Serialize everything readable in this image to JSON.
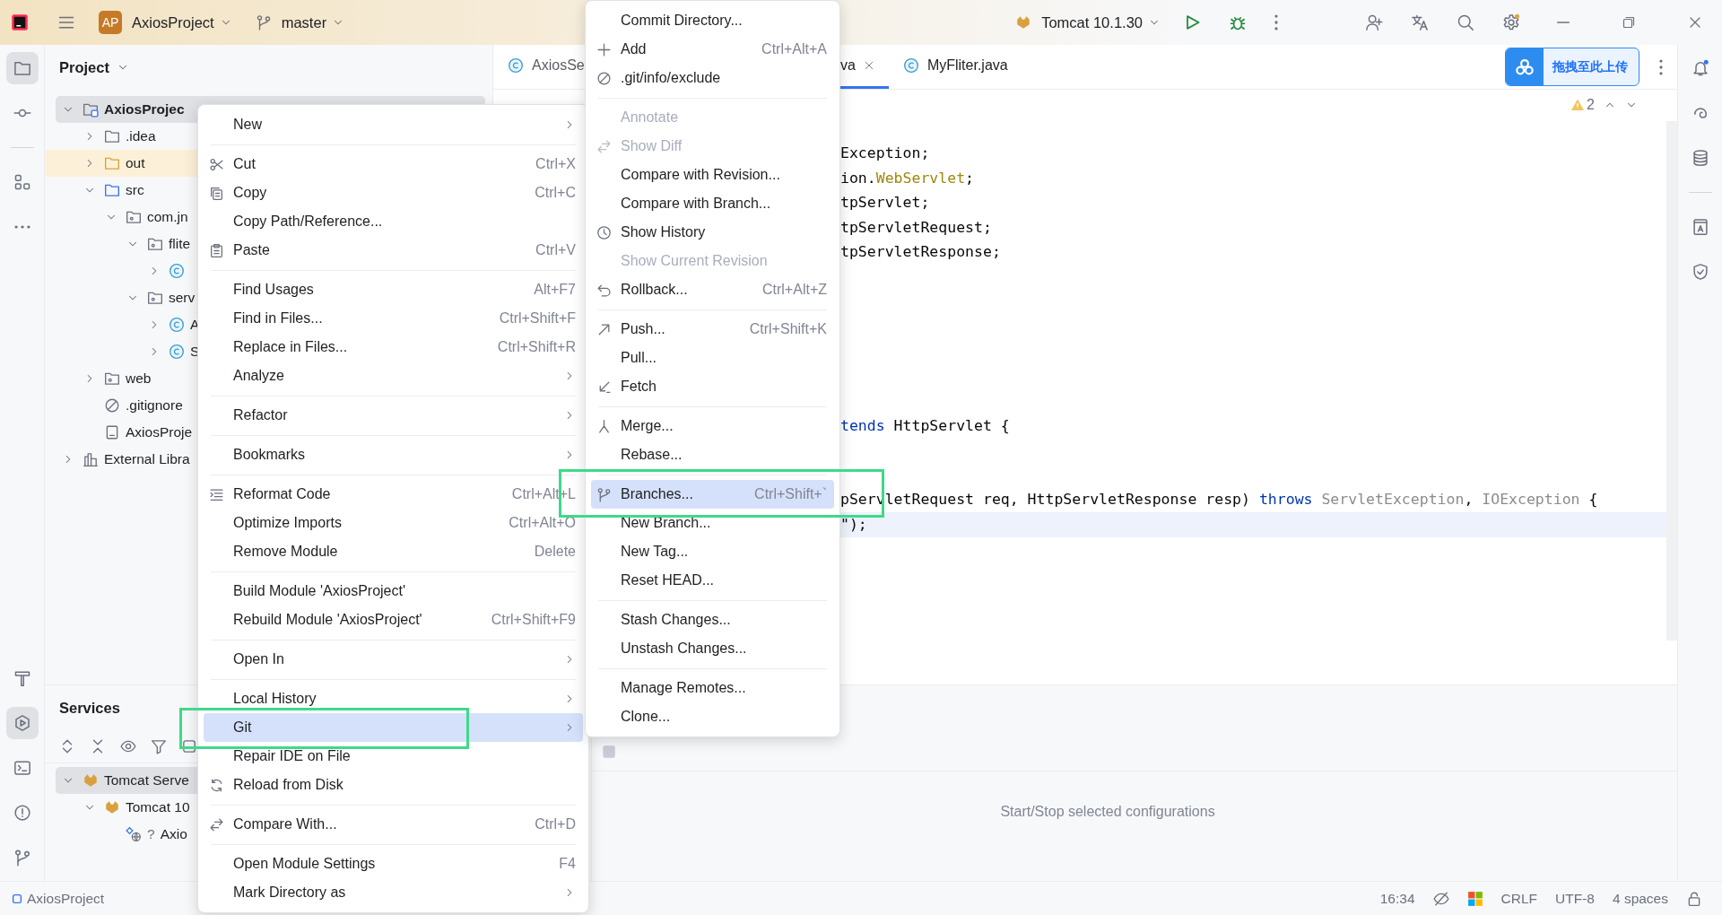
{
  "topbar": {
    "project_badge": "AP",
    "project": "AxiosProject",
    "branch": "master",
    "run_config": "Tomcat 10.1.30"
  },
  "left_toolbar": {
    "top": [
      {
        "selected": true
      },
      {
        "selected": false
      },
      {
        "selected": false
      },
      {
        "selected": false
      }
    ],
    "bottom": [
      {
        "selected": false
      },
      {
        "selected": true
      },
      {
        "selected": false
      },
      {
        "selected": false
      },
      {
        "selected": false
      }
    ]
  },
  "project": {
    "title": "Project",
    "tree": [
      {
        "label": "AxiosProjec",
        "kind": "module",
        "expanded": true,
        "selected": true,
        "excluded": false,
        "children": [
          {
            "label": ".idea",
            "kind": "folder",
            "expanded": false,
            "selected": false,
            "excluded": false
          },
          {
            "label": "out",
            "kind": "folder",
            "expanded": false,
            "selected": false,
            "excluded": true
          },
          {
            "label": "src",
            "kind": "source",
            "expanded": true,
            "selected": false,
            "excluded": false,
            "children": [
              {
                "label": "com.jn",
                "kind": "package",
                "expanded": true,
                "selected": false,
                "excluded": false,
                "children": [
                  {
                    "label": "flite",
                    "kind": "package",
                    "expanded": true,
                    "selected": false,
                    "excluded": false,
                    "children": [
                      {
                        "kind": "class",
                        "expanded": false,
                        "selected": false,
                        "excluded": false
                      }
                    ]
                  },
                  {
                    "label": "serv",
                    "kind": "package",
                    "expanded": true,
                    "selected": false,
                    "excluded": false,
                    "children": [
                      {
                        "label": "A",
                        "kind": "class",
                        "expanded": false,
                        "selected": false,
                        "excluded": false
                      },
                      {
                        "label": "S",
                        "kind": "class",
                        "expanded": false,
                        "selected": false,
                        "excluded": false
                      }
                    ]
                  }
                ]
              }
            ]
          },
          {
            "label": "web",
            "kind": "package",
            "expanded": false,
            "selected": false,
            "excluded": false
          },
          {
            "label": ".gitignore",
            "kind": "ignore",
            "selected": false,
            "excluded": false
          },
          {
            "label": "AxiosProje",
            "kind": "file",
            "selected": false,
            "excluded": false
          }
        ]
      },
      {
        "label": "External Libra",
        "kind": "library",
        "expanded": false,
        "selected": false,
        "excluded": false
      }
    ]
  },
  "editor": {
    "tabs": [
      {
        "label": "AxiosSe",
        "kind": "class",
        "selected": false
      },
      {
        "label": "va",
        "kind": "plain",
        "selected": true,
        "closable": true
      },
      {
        "label": "MyFliter.java",
        "kind": "class",
        "selected": false,
        "closable": false
      }
    ],
    "upload_button": "拖拽至此上传",
    "warnings": "2",
    "lines": [
      {
        "kind": "code",
        "current": false,
        "segments": [
          {
            "kind": "plain",
            "text": "Exception;"
          }
        ]
      },
      {
        "kind": "code",
        "current": false,
        "segments": [
          {
            "kind": "plain",
            "text": "ion."
          },
          {
            "kind": "annotation",
            "text": "WebServlet"
          },
          {
            "kind": "plain",
            "text": ";"
          }
        ]
      },
      {
        "kind": "code",
        "current": false,
        "segments": [
          {
            "kind": "plain",
            "text": "tpServlet;"
          }
        ]
      },
      {
        "kind": "code",
        "current": false,
        "segments": [
          {
            "kind": "plain",
            "text": "tpServletRequest;"
          }
        ]
      },
      {
        "kind": "code",
        "current": false,
        "segments": [
          {
            "kind": "plain",
            "text": "tpServletResponse;"
          }
        ]
      },
      {
        "kind": "blank",
        "current": false
      },
      {
        "kind": "blank",
        "current": false
      },
      {
        "kind": "blank",
        "current": false
      },
      {
        "kind": "blank",
        "current": false
      },
      {
        "kind": "blank",
        "current": false
      },
      {
        "kind": "blank",
        "current": false
      },
      {
        "kind": "code",
        "current": false,
        "segments": [
          {
            "kind": "keyword",
            "text": "tends"
          },
          {
            "kind": "plain",
            "text": " HttpServlet {"
          }
        ]
      },
      {
        "kind": "blank",
        "current": false
      },
      {
        "kind": "blank",
        "current": false
      },
      {
        "kind": "code",
        "current": false,
        "segments": [
          {
            "kind": "plain",
            "text": "pServletRequest req, HttpServletResponse resp) "
          },
          {
            "kind": "keyword",
            "text": "throws"
          },
          {
            "kind": "muted",
            "text": " ServletException"
          },
          {
            "kind": "plain",
            "text": ", "
          },
          {
            "kind": "muted",
            "text": "IOException"
          },
          {
            "kind": "plain",
            "text": " {"
          }
        ]
      },
      {
        "kind": "code",
        "current": true,
        "segments": [
          {
            "kind": "plain",
            "text": "\");"
          }
        ]
      }
    ]
  },
  "services": {
    "title": "Services",
    "hint": "Start/Stop selected configurations",
    "tree": [
      {
        "label": "Tomcat Serve",
        "kind": "server",
        "expanded": true,
        "selected": true,
        "children": [
          {
            "label": "Tomcat 10",
            "kind": "server",
            "expanded": true,
            "selected": false,
            "children": [
              {
                "label": "Axio",
                "prefix": "?",
                "kind": "artifact",
                "selected": false
              }
            ]
          }
        ]
      }
    ]
  },
  "status_bar": {
    "project": "AxiosProject",
    "items": [
      {
        "kind": "text",
        "text": "16:34"
      },
      {
        "kind": "vcs"
      },
      {
        "kind": "os"
      },
      {
        "kind": "text",
        "text": "CRLF"
      },
      {
        "kind": "text",
        "text": "UTF-8"
      },
      {
        "kind": "text",
        "text": "4 spaces"
      },
      {
        "kind": "lock"
      }
    ]
  },
  "context_menu": {
    "groups": [
      {
        "items": [
          {
            "label": "New",
            "kind": "plain",
            "submenu": true,
            "selected": false
          }
        ]
      },
      {
        "items": [
          {
            "label": "Cut",
            "shortcut": "Ctrl+X",
            "kind": "cut",
            "submenu": false,
            "selected": false
          },
          {
            "label": "Copy",
            "shortcut": "Ctrl+C",
            "kind": "copy",
            "submenu": false,
            "selected": false
          },
          {
            "label": "Copy Path/Reference...",
            "kind": "plain",
            "submenu": false,
            "selected": false
          },
          {
            "label": "Paste",
            "shortcut": "Ctrl+V",
            "kind": "paste",
            "submenu": false,
            "selected": false
          }
        ]
      },
      {
        "items": [
          {
            "label": "Find Usages",
            "shortcut": "Alt+F7",
            "kind": "plain",
            "submenu": false,
            "selected": false
          },
          {
            "label": "Find in Files...",
            "shortcut": "Ctrl+Shift+F",
            "kind": "plain",
            "submenu": false,
            "selected": false
          },
          {
            "label": "Replace in Files...",
            "shortcut": "Ctrl+Shift+R",
            "kind": "plain",
            "submenu": false,
            "selected": false
          },
          {
            "label": "Analyze",
            "kind": "plain",
            "submenu": true,
            "selected": false
          }
        ]
      },
      {
        "items": [
          {
            "label": "Refactor",
            "kind": "plain",
            "submenu": true,
            "selected": false
          }
        ]
      },
      {
        "items": [
          {
            "label": "Bookmarks",
            "kind": "plain",
            "submenu": true,
            "selected": false
          }
        ]
      },
      {
        "items": [
          {
            "label": "Reformat Code",
            "shortcut": "Ctrl+Alt+L",
            "kind": "format",
            "submenu": false,
            "selected": false
          },
          {
            "label": "Optimize Imports",
            "shortcut": "Ctrl+Alt+O",
            "kind": "plain",
            "submenu": false,
            "selected": false
          },
          {
            "label": "Remove Module",
            "shortcut": "Delete",
            "kind": "plain",
            "submenu": false,
            "selected": false
          }
        ]
      },
      {
        "items": [
          {
            "label": "Build Module 'AxiosProject'",
            "kind": "plain",
            "submenu": false,
            "selected": false
          },
          {
            "label": "Rebuild Module 'AxiosProject'",
            "shortcut": "Ctrl+Shift+F9",
            "kind": "plain",
            "submenu": false,
            "selected": false
          }
        ]
      },
      {
        "items": [
          {
            "label": "Open In",
            "kind": "plain",
            "submenu": true,
            "selected": false
          }
        ]
      },
      {
        "items": [
          {
            "label": "Local History",
            "kind": "plain",
            "submenu": true,
            "selected": false
          },
          {
            "label": "Git",
            "kind": "plain",
            "submenu": true,
            "selected": true
          },
          {
            "label": "Repair IDE on File",
            "kind": "plain",
            "submenu": false,
            "selected": false
          },
          {
            "label": "Reload from Disk",
            "kind": "reload",
            "submenu": false,
            "selected": false
          }
        ]
      },
      {
        "items": [
          {
            "label": "Compare With...",
            "shortcut": "Ctrl+D",
            "kind": "compare",
            "submenu": false,
            "selected": false
          }
        ]
      },
      {
        "items": [
          {
            "label": "Open Module Settings",
            "shortcut": "F4",
            "kind": "plain",
            "submenu": false,
            "selected": false
          },
          {
            "label": "Mark Directory as",
            "kind": "plain",
            "submenu": true,
            "selected": false
          }
        ]
      }
    ]
  },
  "git_menu": {
    "groups": [
      {
        "items": [
          {
            "label": "Commit Directory...",
            "kind": "plain",
            "disabled": false,
            "selected": false
          },
          {
            "label": "Add",
            "shortcut": "Ctrl+Alt+A",
            "kind": "add",
            "disabled": false,
            "selected": false
          },
          {
            "label": ".git/info/exclude",
            "kind": "exclude",
            "disabled": false,
            "selected": false
          }
        ]
      },
      {
        "items": [
          {
            "label": "Annotate",
            "kind": "plain",
            "disabled": true,
            "selected": false
          },
          {
            "label": "Show Diff",
            "kind": "compare",
            "disabled": true,
            "selected": false
          },
          {
            "label": "Compare with Revision...",
            "kind": "plain",
            "disabled": false,
            "selected": false
          },
          {
            "label": "Compare with Branch...",
            "kind": "plain",
            "disabled": false,
            "selected": false
          },
          {
            "label": "Show History",
            "kind": "history",
            "disabled": false,
            "selected": false
          },
          {
            "label": "Show Current Revision",
            "kind": "plain",
            "disabled": true,
            "selected": false
          },
          {
            "label": "Rollback...",
            "shortcut": "Ctrl+Alt+Z",
            "kind": "rollback",
            "disabled": false,
            "selected": false
          }
        ]
      },
      {
        "items": [
          {
            "label": "Push...",
            "shortcut": "Ctrl+Shift+K",
            "kind": "push",
            "disabled": false,
            "selected": false
          },
          {
            "label": "Pull...",
            "kind": "plain",
            "disabled": false,
            "selected": false
          },
          {
            "label": "Fetch",
            "kind": "fetch",
            "disabled": false,
            "selected": false
          }
        ]
      },
      {
        "items": [
          {
            "label": "Merge...",
            "kind": "merge",
            "disabled": false,
            "selected": false
          },
          {
            "label": "Rebase...",
            "kind": "plain",
            "disabled": false,
            "selected": false
          }
        ]
      },
      {
        "items": [
          {
            "label": "Branches...",
            "shortcut": "Ctrl+Shift+`",
            "kind": "branches",
            "disabled": false,
            "selected": true
          },
          {
            "label": "New Branch...",
            "kind": "plain",
            "disabled": false,
            "selected": false
          },
          {
            "label": "New Tag...",
            "kind": "plain",
            "disabled": false,
            "selected": false
          },
          {
            "label": "Reset HEAD...",
            "kind": "plain",
            "disabled": false,
            "selected": false
          }
        ]
      },
      {
        "items": [
          {
            "label": "Stash Changes...",
            "kind": "plain",
            "disabled": false,
            "selected": false
          },
          {
            "label": "Unstash Changes...",
            "kind": "plain",
            "disabled": false,
            "selected": false
          }
        ]
      },
      {
        "items": [
          {
            "label": "Manage Remotes...",
            "kind": "plain",
            "disabled": false,
            "selected": false
          },
          {
            "label": "Clone...",
            "kind": "plain",
            "disabled": false,
            "selected": false
          }
        ]
      }
    ]
  }
}
